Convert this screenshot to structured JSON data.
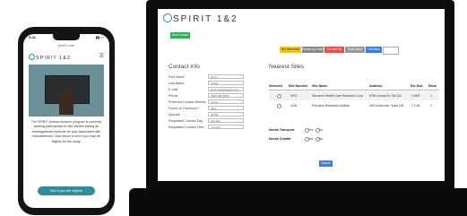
{
  "mobile": {
    "status_time": "9:41",
    "url": "spirit12.com",
    "logo_text": "SPIRIT 1&2",
    "menu_icon": "hamburger-icon",
    "paragraph": "The SPIRIT clinical research program is currently seeking participants for two studies testing an investigational medicine for pain associated with endometriosis. Click below to see if you may be eligible for the study.",
    "cta_label": "See if you are eligible"
  },
  "desktop": {
    "logo_text": "SPIRIT 1&2",
    "top_button_label": "New Contact",
    "status_buttons": [
      "Not Interested",
      "Screening Failed",
      "Do not Call",
      "Wait Listed",
      "Call Back"
    ],
    "status_select_value": "",
    "contact": {
      "title": "Contact Info",
      "fields": [
        {
          "label": "First Name",
          "value": "jenny"
        },
        {
          "label": "Last Name",
          "value": "hodge"
        },
        {
          "label": "E-mail",
          "value": "jenny.hodge@abccom.c"
        },
        {
          "label": "Phone",
          "value": "(555) 555-5555"
        },
        {
          "label": "Preferred Contact Method",
          "value": "phone"
        },
        {
          "label": "Found on Facebook?",
          "value": "false"
        },
        {
          "label": "Zipcode",
          "value": "45789"
        },
        {
          "label": "Requested Contact Day",
          "value": "Monday"
        },
        {
          "label": "Requested Contact Time",
          "value": "morning"
        }
      ]
    },
    "sites": {
      "title": "Nearest Sites",
      "headers": [
        "Selected",
        "Site Number",
        "Site Name",
        "Address",
        "Est Dist.",
        "Rank"
      ],
      "rows": [
        {
          "site_number": "1972",
          "site_name": "Women's Health Care Research Corp",
          "address": "8780 Linney St, Ste 311",
          "dist": "2.5MT",
          "rank": "1"
        },
        {
          "site_number": "1106",
          "site_name": "Precision Research Institute",
          "address": "260 Euclid Ave, Suite 115",
          "dist": "7.1 MI",
          "rank": "2"
        }
      ]
    },
    "questions": [
      {
        "label": "Needs Transport",
        "options": [
          "Yes",
          "No"
        ]
      },
      {
        "label": "Needs Chartlit",
        "options": [
          "Yes",
          "No"
        ]
      }
    ],
    "submit_label": "Submit"
  }
}
